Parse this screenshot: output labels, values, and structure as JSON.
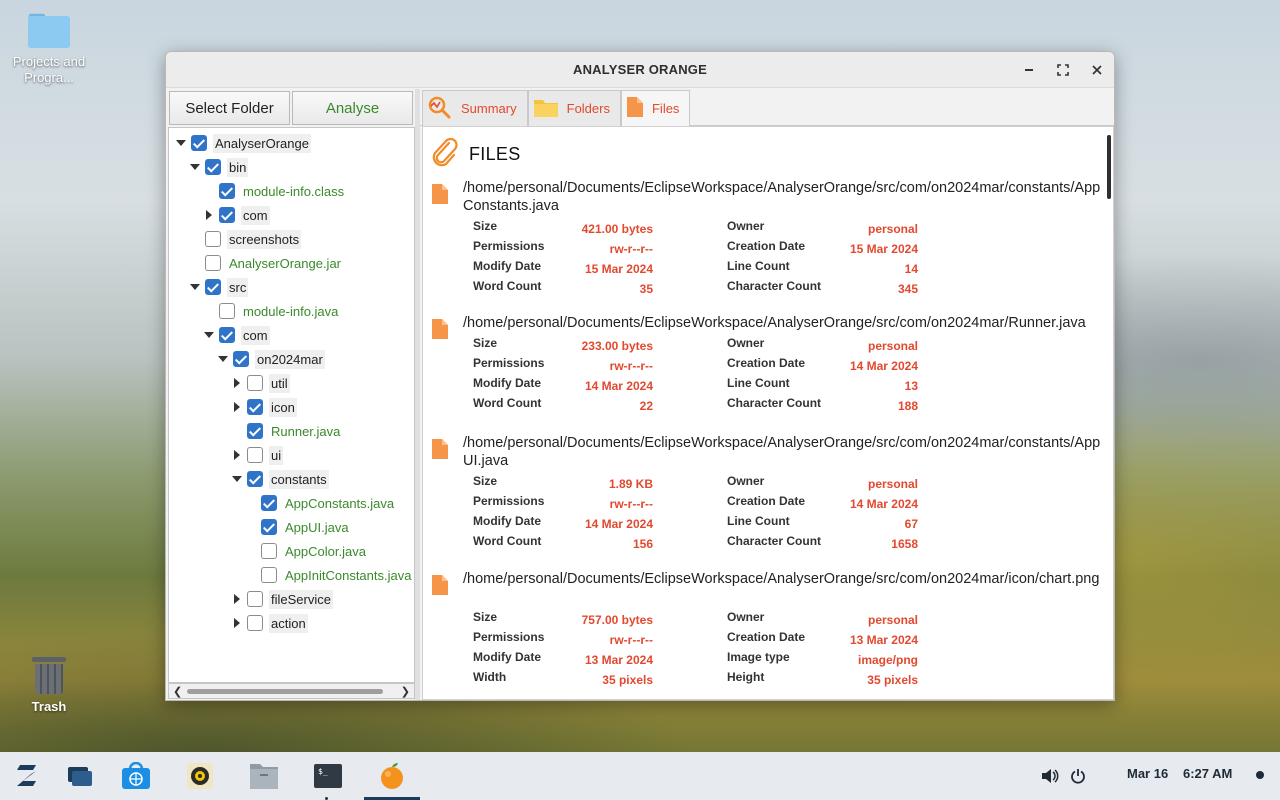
{
  "desktop": {
    "icons": [
      {
        "label": "Projects and Progra...",
        "icon": "folder-icon"
      },
      {
        "label": "Trash",
        "icon": "trash-icon"
      }
    ]
  },
  "window": {
    "title": "ANALYSER ORANGE",
    "controls": [
      "minimize",
      "maximize",
      "close"
    ]
  },
  "toolbar": {
    "select_folder_label": "Select Folder",
    "analyse_label": "Analyse"
  },
  "tree": [
    {
      "label": "AnalyserOrange",
      "depth": 0,
      "arrow": "down",
      "checked": true,
      "kind": "folder"
    },
    {
      "label": "bin",
      "depth": 1,
      "arrow": "down",
      "checked": true,
      "kind": "folder"
    },
    {
      "label": "module-info.class",
      "depth": 2,
      "arrow": "",
      "checked": true,
      "kind": "file"
    },
    {
      "label": "com",
      "depth": 2,
      "arrow": "right",
      "checked": true,
      "kind": "folder"
    },
    {
      "label": "screenshots",
      "depth": 1,
      "arrow": "",
      "checked": false,
      "kind": "folder"
    },
    {
      "label": "AnalyserOrange.jar",
      "depth": 1,
      "arrow": "",
      "checked": false,
      "kind": "file"
    },
    {
      "label": "src",
      "depth": 1,
      "arrow": "down",
      "checked": true,
      "kind": "folder"
    },
    {
      "label": "module-info.java",
      "depth": 2,
      "arrow": "",
      "checked": false,
      "kind": "file"
    },
    {
      "label": "com",
      "depth": 2,
      "arrow": "down",
      "checked": true,
      "kind": "folder"
    },
    {
      "label": "on2024mar",
      "depth": 3,
      "arrow": "down",
      "checked": true,
      "kind": "folder"
    },
    {
      "label": "util",
      "depth": 4,
      "arrow": "right",
      "checked": false,
      "kind": "folder"
    },
    {
      "label": "icon",
      "depth": 4,
      "arrow": "right",
      "checked": true,
      "kind": "folder"
    },
    {
      "label": "Runner.java",
      "depth": 4,
      "arrow": "",
      "checked": true,
      "kind": "file"
    },
    {
      "label": "ui",
      "depth": 4,
      "arrow": "right",
      "checked": false,
      "kind": "folder"
    },
    {
      "label": "constants",
      "depth": 4,
      "arrow": "down",
      "checked": true,
      "kind": "folder"
    },
    {
      "label": "AppConstants.java",
      "depth": 5,
      "arrow": "",
      "checked": true,
      "kind": "file"
    },
    {
      "label": "AppUI.java",
      "depth": 5,
      "arrow": "",
      "checked": true,
      "kind": "file"
    },
    {
      "label": "AppColor.java",
      "depth": 5,
      "arrow": "",
      "checked": false,
      "kind": "file"
    },
    {
      "label": "AppInitConstants.java",
      "depth": 5,
      "arrow": "",
      "checked": false,
      "kind": "file"
    },
    {
      "label": "fileService",
      "depth": 4,
      "arrow": "right",
      "checked": false,
      "kind": "folder"
    },
    {
      "label": "action",
      "depth": 4,
      "arrow": "right",
      "checked": false,
      "kind": "folder"
    }
  ],
  "tabs": [
    {
      "label": "Summary",
      "icon": "summary-icon",
      "active": false
    },
    {
      "label": "Folders",
      "icon": "folder-icon",
      "active": false
    },
    {
      "label": "Files",
      "icon": "file-icon",
      "active": true
    }
  ],
  "files_panel": {
    "heading": "FILES",
    "entries": [
      {
        "path": "/home/personal/Documents/EclipseWorkspace/AnalyserOrange/src/com/on2024mar/constants/AppConstants.java",
        "left": [
          {
            "k": "Size",
            "v": "421.00 bytes"
          },
          {
            "k": "Permissions",
            "v": "rw-r--r--"
          },
          {
            "k": "Modify Date",
            "v": "15 Mar 2024"
          },
          {
            "k": "Word Count",
            "v": "35"
          }
        ],
        "right": [
          {
            "k": "Owner",
            "v": "personal"
          },
          {
            "k": "Creation Date",
            "v": "15 Mar 2024"
          },
          {
            "k": "Line Count",
            "v": "14"
          },
          {
            "k": "Character Count",
            "v": "345"
          }
        ]
      },
      {
        "path": "/home/personal/Documents/EclipseWorkspace/AnalyserOrange/src/com/on2024mar/Runner.java",
        "left": [
          {
            "k": "Size",
            "v": "233.00 bytes"
          },
          {
            "k": "Permissions",
            "v": "rw-r--r--"
          },
          {
            "k": "Modify Date",
            "v": "14 Mar 2024"
          },
          {
            "k": "Word Count",
            "v": "22"
          }
        ],
        "right": [
          {
            "k": "Owner",
            "v": "personal"
          },
          {
            "k": "Creation Date",
            "v": "14 Mar 2024"
          },
          {
            "k": "Line Count",
            "v": "13"
          },
          {
            "k": "Character Count",
            "v": "188"
          }
        ]
      },
      {
        "path": "/home/personal/Documents/EclipseWorkspace/AnalyserOrange/src/com/on2024mar/constants/AppUI.java",
        "left": [
          {
            "k": "Size",
            "v": "1.89 KB"
          },
          {
            "k": "Permissions",
            "v": "rw-r--r--"
          },
          {
            "k": "Modify Date",
            "v": "14 Mar 2024"
          },
          {
            "k": "Word Count",
            "v": "156"
          }
        ],
        "right": [
          {
            "k": "Owner",
            "v": "personal"
          },
          {
            "k": "Creation Date",
            "v": "14 Mar 2024"
          },
          {
            "k": "Line Count",
            "v": "67"
          },
          {
            "k": "Character Count",
            "v": "1658"
          }
        ]
      },
      {
        "path": "/home/personal/Documents/EclipseWorkspace/AnalyserOrange/src/com/on2024mar/icon/chart.png",
        "left": [
          {
            "k": "Size",
            "v": "757.00 bytes"
          },
          {
            "k": "Permissions",
            "v": "rw-r--r--"
          },
          {
            "k": "Modify Date",
            "v": "13 Mar 2024"
          },
          {
            "k": "Width",
            "v": "35 pixels"
          }
        ],
        "right": [
          {
            "k": "Owner",
            "v": "personal"
          },
          {
            "k": "Creation Date",
            "v": "13 Mar 2024"
          },
          {
            "k": "Image type",
            "v": "image/png"
          },
          {
            "k": "Height",
            "v": "35 pixels"
          }
        ]
      }
    ]
  },
  "taskbar": {
    "apps": [
      "zorin-menu-icon",
      "workspaces-icon",
      "software-store-icon",
      "rhythmbox-icon",
      "files-icon",
      "terminal-icon",
      "analyser-orange-icon"
    ],
    "date": "Mar 16",
    "time": "6:27 AM"
  },
  "colors": {
    "accent_red": "#e2492f",
    "file_green": "#3a8a2a",
    "checkbox_blue": "#2f74c9"
  }
}
